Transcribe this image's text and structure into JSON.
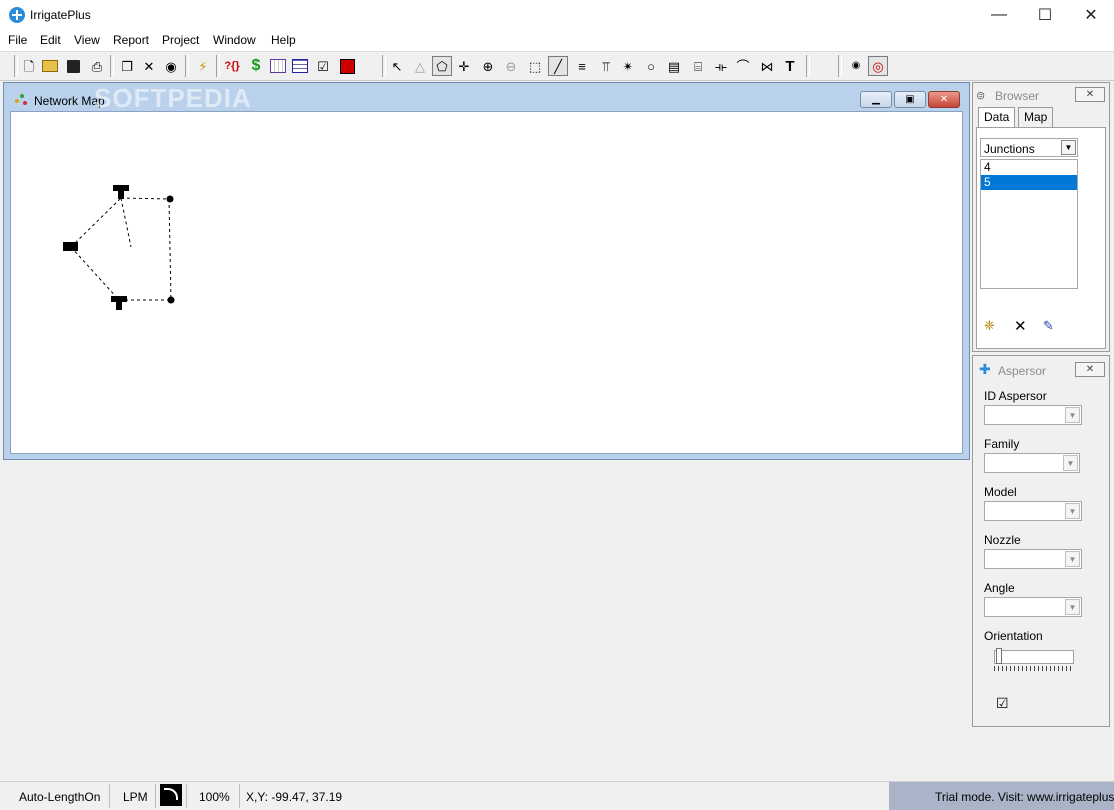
{
  "app": {
    "title": "IrrigatePlus"
  },
  "menu": [
    "File",
    "Edit",
    "View",
    "Report",
    "Project",
    "Window",
    "Help"
  ],
  "network_map": {
    "title": "Network Map",
    "watermark": "SOFTPEDIA"
  },
  "browser": {
    "title": "Browser",
    "tabs": [
      "Data",
      "Map"
    ],
    "selected_tab": "Data",
    "category": "Junctions",
    "items": [
      "4",
      "5"
    ],
    "selected_item": "5"
  },
  "aspersor": {
    "title": "Aspersor",
    "fields": [
      "ID Aspersor",
      "Family",
      "Model",
      "Nozzle",
      "Angle"
    ],
    "orientation_label": "Orientation"
  },
  "status": {
    "auto_length": "Auto-LengthOn",
    "flow_units": "LPM",
    "zoom": "100%",
    "coords": "X,Y: -99.47, 37.19",
    "trial": "Trial mode. Visit: www.irrigateplus.com"
  },
  "toolbar_text": {
    "query": "?{}",
    "cost": "$",
    "text_tool": "T"
  },
  "colors": {
    "selection": "#0078d7",
    "trial_bg": "#aab4c8",
    "mdi_frame": "#b9d1ea"
  }
}
